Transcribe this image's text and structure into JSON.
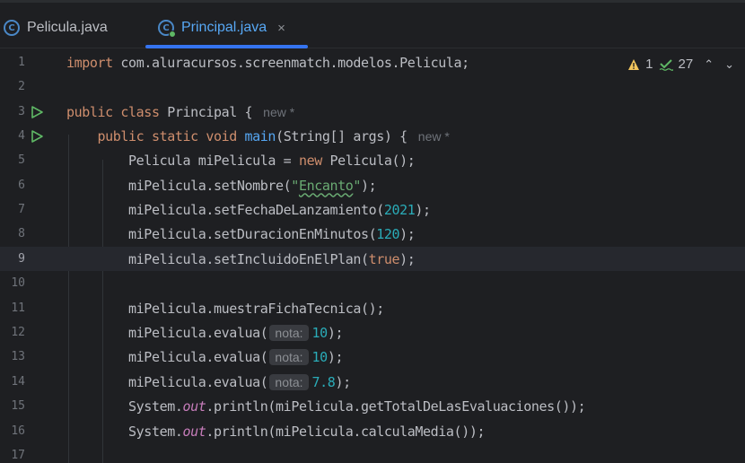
{
  "tabs": [
    {
      "label": "Pelicula.java",
      "icon": "class-icon",
      "active": false
    },
    {
      "label": "Principal.java",
      "icon": "class-run-icon",
      "active": true,
      "close": "×"
    }
  ],
  "inspections": {
    "warnings": "1",
    "weak_warnings": "27",
    "up": "⌃",
    "down": "⌄"
  },
  "editor": {
    "line_numbers": [
      "1",
      "2",
      "3",
      "4",
      "5",
      "6",
      "7",
      "8",
      "9",
      "10",
      "11",
      "12",
      "13",
      "14",
      "15",
      "16",
      "17"
    ],
    "current_line": "9",
    "author_hint": "new *",
    "param_hint": "nota:",
    "lines": {
      "l1": {
        "kw": "import",
        "rest": " com.aluracursos.screenmatch.modelos.Pelicula;"
      },
      "l3": {
        "kw": "public class",
        "rest": " Principal {"
      },
      "l4": {
        "kw": "public static void",
        "fn": "main",
        "rest": "(String[] args) {"
      },
      "l5": {
        "a": "Pelicula miPelicula = ",
        "kw": "new",
        "b": " Pelicula();"
      },
      "l6": {
        "a": "miPelicula.setNombre(",
        "str_q1": "\"",
        "str": "Encanto",
        "str_q2": "\"",
        "b": ");"
      },
      "l7": {
        "a": "miPelicula.setFechaDeLanzamiento(",
        "num": "2021",
        "b": ");"
      },
      "l8": {
        "a": "miPelicula.setDuracionEnMinutos(",
        "num": "120",
        "b": ");"
      },
      "l9": {
        "a": "miPelicula.setIncluidoEnElPlan(",
        "kw": "true",
        "b": ");"
      },
      "l11": {
        "a": "miPelicula.muestraFichaTecnica();"
      },
      "l12": {
        "a": "miPelicula.evalua(",
        "num": "10",
        "b": ");"
      },
      "l13": {
        "a": "miPelicula.evalua(",
        "num": "10",
        "b": ");"
      },
      "l14": {
        "a": "miPelicula.evalua(",
        "num": "7.8",
        "b": ");"
      },
      "l15": {
        "a": "System.",
        "field": "out",
        "b": ".println(miPelicula.getTotalDeLasEvaluaciones());"
      },
      "l16": {
        "a": "System.",
        "field": "out",
        "b": ".println(miPelicula.calculaMedia());"
      }
    }
  },
  "colors": {
    "background": "#1e1f22",
    "keyword": "#cf8e6d",
    "function": "#56a8f5",
    "string": "#6aab73",
    "number": "#2aacb8",
    "field": "#c77dbb",
    "accent": "#3574f0"
  }
}
